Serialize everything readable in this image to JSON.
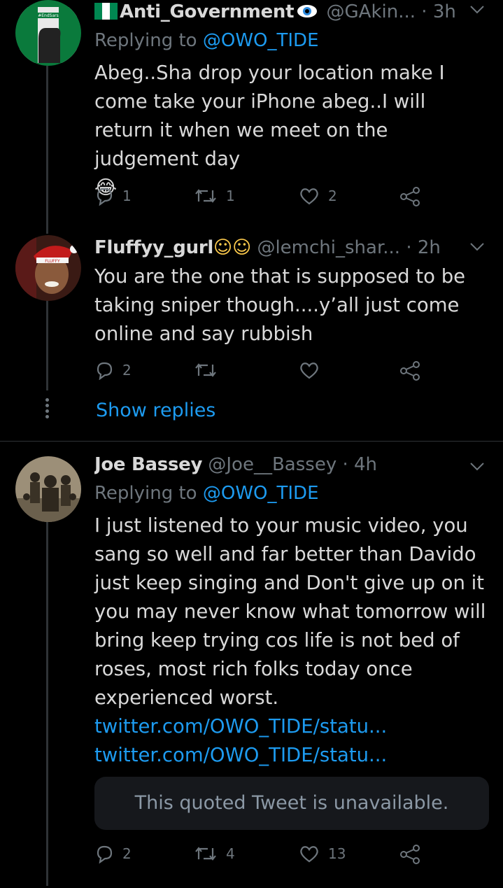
{
  "tweets": [
    {
      "name": "Anti_Government",
      "handle": "@GAkin...",
      "time": "· 3h",
      "replying_prefix": "Replying to",
      "replying_to": "@OWO_TIDE",
      "text": "Abeg..Sha drop your location make I come take your iPhone abeg..I will return it when we meet on the judgement day",
      "emoji": "😂",
      "replies": "1",
      "retweets": "1",
      "likes": "2",
      "avatar_badge": "#EndSars"
    },
    {
      "name": "Fluffyy_gurl",
      "name_emoji": "☺☺",
      "handle": "@lemchi_shar...",
      "time": "· 2h",
      "text": "You are the one that is supposed to be taking sniper though....y’all just come online and say rubbish",
      "replies": "2",
      "retweets": "",
      "likes": "",
      "avatar_hat_text": "FLUFFY"
    },
    {
      "name": "Joe Bassey",
      "handle": "@Joe__Bassey",
      "time": "· 4h",
      "replying_prefix": "Replying to",
      "replying_to": "@OWO_TIDE",
      "text": "I just listened to your music video, you sang so well and far better than Davido just keep singing and Don't give up on it you may never know what tomorrow will bring keep trying cos life is not bed of roses, most rich folks today once experienced worst.",
      "links": [
        "twitter.com/OWO_TIDE/statu...",
        "twitter.com/OWO_TIDE/statu..."
      ],
      "quoted_unavailable": "This quoted Tweet is unavailable.",
      "replies": "2",
      "retweets": "4",
      "likes": "13"
    }
  ],
  "show_replies": "Show replies",
  "icons": [
    "chevron-down-icon",
    "reply-icon",
    "retweet-icon",
    "like-icon",
    "share-icon",
    "more-dots-icon"
  ],
  "colors": {
    "background": "#000000",
    "link": "#1d9bf0",
    "muted": "#6e767d",
    "text": "#d9d9d9",
    "flag_green": "#008751"
  }
}
